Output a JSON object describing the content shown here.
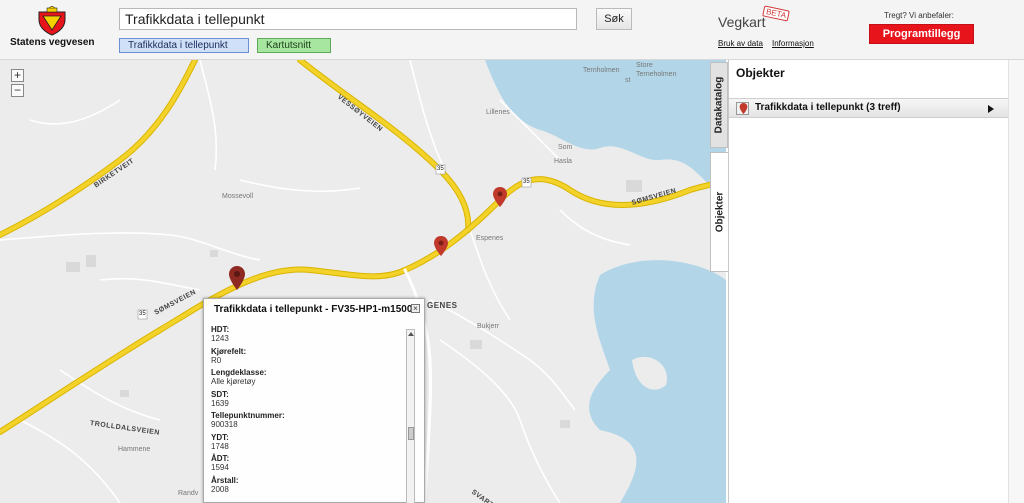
{
  "header": {
    "logo_text": "Statens vegvesen",
    "search_value": "Trafikkdata i tellepunkt",
    "search_button": "Søk",
    "chip_active": "Trafikkdata i tellepunkt",
    "chip_map": "Kartutsnitt",
    "brand_name": "Vegkart",
    "brand_beta": "BETA",
    "link_help": "Bruk av data",
    "link_info": "Informasjon",
    "slow_text": "Tregt? Vi anbefaler:",
    "plugin_button": "Programtillegg"
  },
  "map": {
    "zoom_in": "+",
    "zoom_out": "−",
    "places": [
      "Ternholmen",
      "Store",
      "Terneholmen",
      "st",
      "Lillenes",
      "Som",
      "Hasla",
      "Mossevoll",
      "Espenes",
      "Hammene",
      "Bukjerr",
      "Randv"
    ],
    "roads": [
      "VESSØYVEIEN",
      "BIRKETVEIT",
      "SØMSVEIEN",
      "SØMSVEIEN",
      "TROLLDALSVEIEN",
      "SVART D",
      "GENES"
    ],
    "road_numbers": [
      "35",
      "35",
      "35"
    ],
    "pin_color": "#c0392b"
  },
  "popup": {
    "title": "Trafikkdata i tellepunkt - FV35-HP1-m1500",
    "close": "×",
    "rows": [
      {
        "label": "HDT:",
        "value": "1243"
      },
      {
        "label": "Kjørefelt:",
        "value": "R0"
      },
      {
        "label": "Lengdeklasse:",
        "value": "Alle kjøretøy"
      },
      {
        "label": "SDT:",
        "value": "1639"
      },
      {
        "label": "Tellepunktnummer:",
        "value": "900318"
      },
      {
        "label": "YDT:",
        "value": "1748"
      },
      {
        "label": "ÅDT:",
        "value": "1594"
      },
      {
        "label": "Årstall:",
        "value": "2008"
      }
    ]
  },
  "tabs": {
    "datakatalog": "Datakatalog",
    "objekter": "Objekter"
  },
  "panel": {
    "title": "Objekter",
    "row_label": "Trafikkdata i tellepunkt (3 treff)"
  },
  "colors": {
    "road_main": "#f3d22a",
    "road_edge": "#d9b400",
    "water": "#b2d6e8",
    "plugin": "#e8141b",
    "chip_blue": "#cfe0f8",
    "chip_green": "#a6e6a0"
  }
}
